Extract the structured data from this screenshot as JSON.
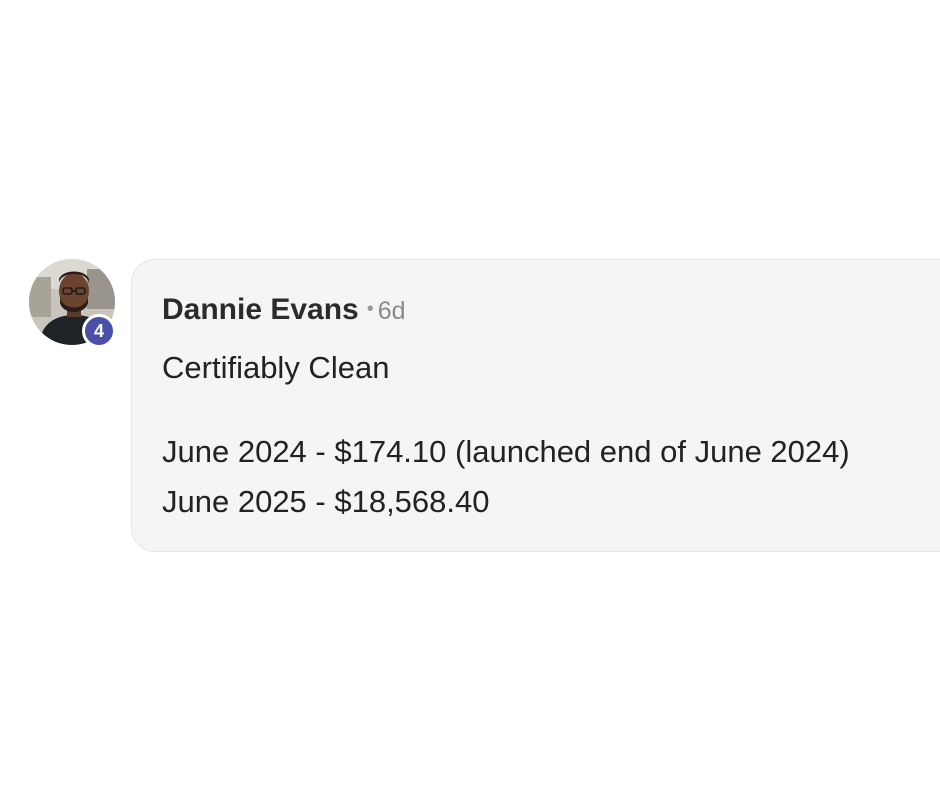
{
  "comment": {
    "author": "Dannie Evans",
    "separator": "•",
    "time_ago": "6d",
    "level_badge": "4",
    "title_line": "Certifiably Clean",
    "lines": [
      "June 2024 - $174.10 (launched end of June 2024)",
      "June 2025 - $18,568.40"
    ]
  },
  "colors": {
    "bubble_background": "#f5f5f4",
    "badge_background": "#4a50a8",
    "author_text": "#2b2b2b",
    "meta_text": "#8a8a8a"
  }
}
